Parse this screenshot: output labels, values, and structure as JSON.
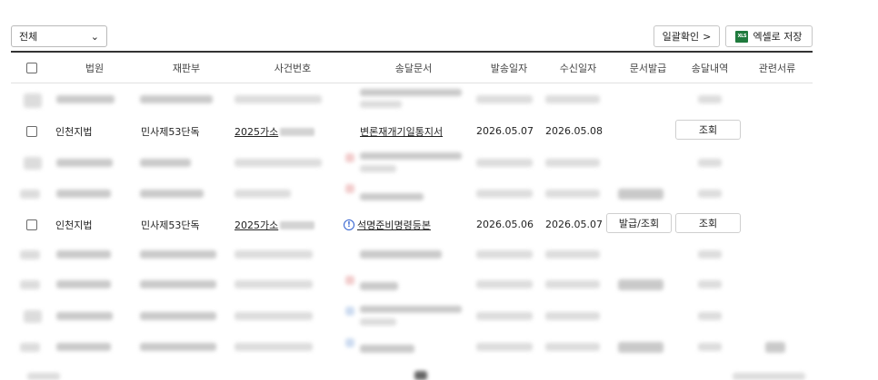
{
  "toolbar": {
    "filter_value": "전체",
    "bulk_confirm_label": "일괄확인",
    "bulk_confirm_arrow": ">",
    "excel_icon_text": "XLS",
    "excel_label": "엑셀로 저장"
  },
  "table": {
    "headers": [
      "법원",
      "재판부",
      "사건번호",
      "송달문서",
      "발송일자",
      "수신일자",
      "문서발급",
      "송달내역",
      "관련서류"
    ],
    "visible_rows": [
      {
        "court": "인천지법",
        "division": "민사제53단독",
        "case_prefix": "2025가소",
        "document": "변론재개기일통지서",
        "sent_date": "2026.05.07",
        "received_date": "2026.05.08",
        "view_label": "조회"
      },
      {
        "court": "인천지법",
        "division": "민사제53단독",
        "case_prefix": "2025가소",
        "warning_icon": "!",
        "document": "석명준비명령등본",
        "sent_date": "2026.05.06",
        "received_date": "2026.05.07",
        "issue_label": "발급/조회",
        "view_label": "조회"
      }
    ]
  },
  "colors": {
    "header_rule": "#333333",
    "excel_green": "#1f7a3d",
    "warning_blue": "#2f5fcf"
  }
}
